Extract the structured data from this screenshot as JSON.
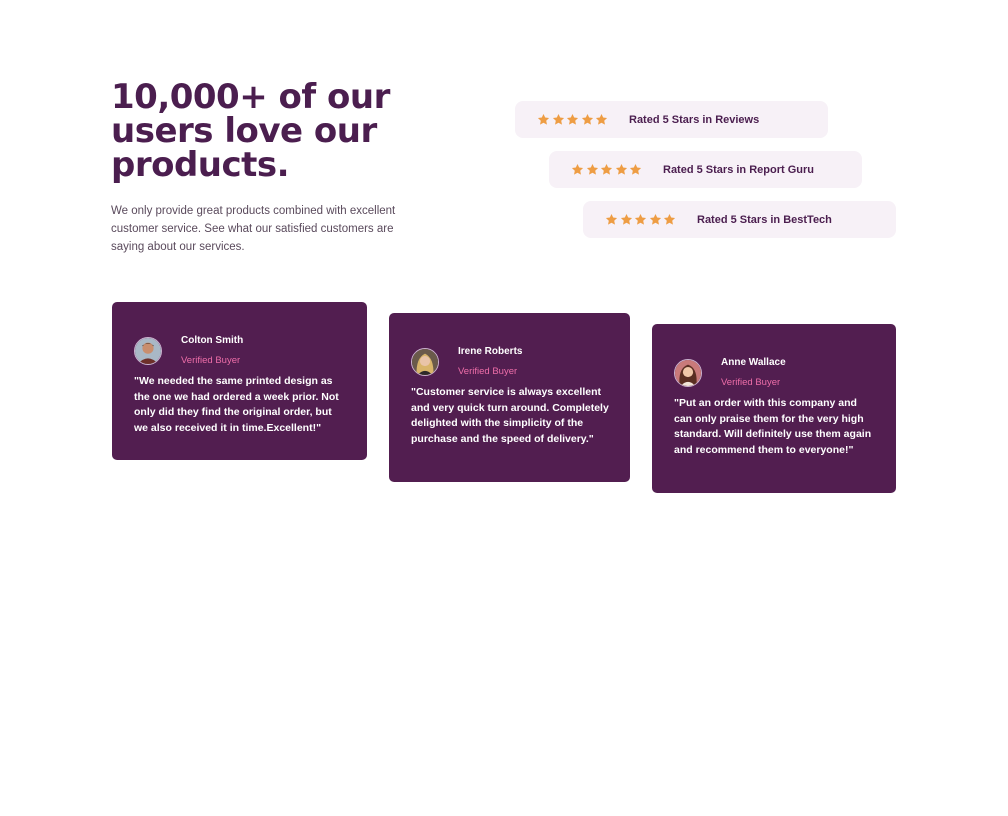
{
  "hero": {
    "title": "10,000+ of our users love our products.",
    "description": "We only provide great products combined with excellent customer service. See what our satisfied customers are saying about our services."
  },
  "ratings": [
    {
      "stars": 5,
      "label": "Rated 5 Stars in Reviews"
    },
    {
      "stars": 5,
      "label": "Rated 5 Stars in Report Guru"
    },
    {
      "stars": 5,
      "label": "Rated 5 Stars in BestTech"
    }
  ],
  "testimonials": [
    {
      "name": "Colton Smith",
      "badge": "Verified Buyer",
      "quote": "\"We needed the same printed design as the one we had ordered a week prior. Not only did they find the original order, but we also received it in time.Excellent!\""
    },
    {
      "name": "Irene Roberts",
      "badge": "Verified Buyer",
      "quote": "\"Customer service is always excellent and very quick turn around. Completely delighted with the simplicity of the purchase and the speed of delivery.\""
    },
    {
      "name": "Anne Wallace",
      "badge": "Verified Buyer",
      "quote": "\"Put an order with this company and can only praise them for the very high standard. Will definitely use them again and recommend them to everyone!\""
    }
  ],
  "colors": {
    "brand": "#4b1e4f",
    "card_bg": "#521e50",
    "rating_bg": "#f7f1f7",
    "star": "#ee9d44",
    "badge": "#ee6ea9"
  },
  "icons": {
    "star": "star-icon"
  }
}
